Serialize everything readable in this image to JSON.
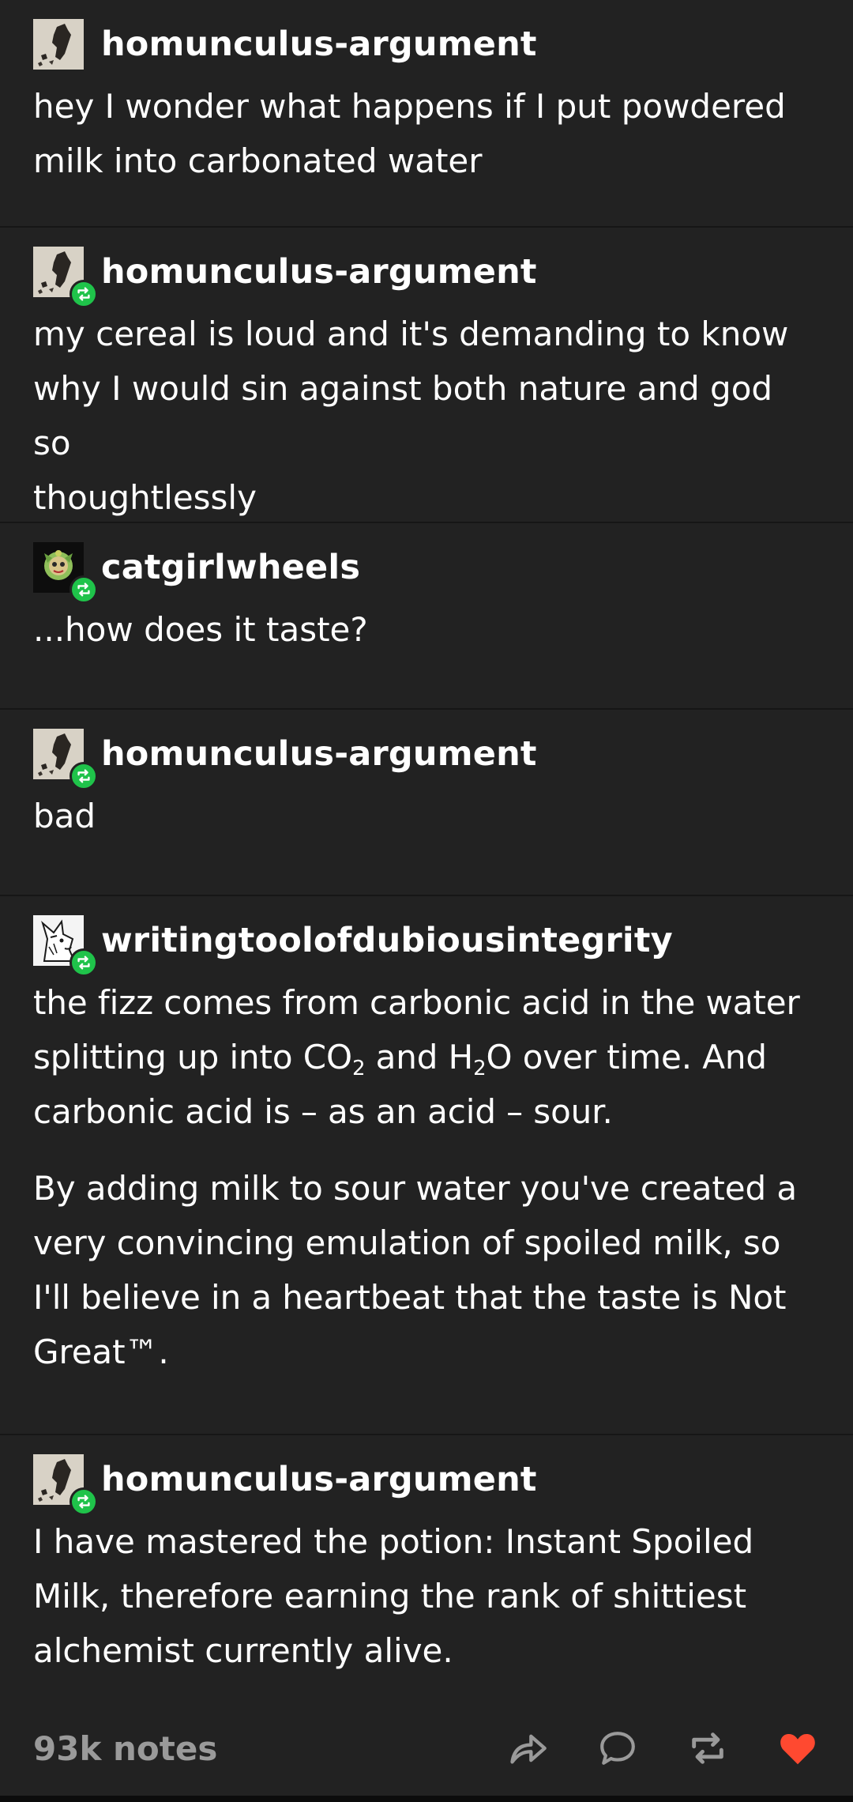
{
  "posts": [
    {
      "username": "homunculus-argument",
      "avatar": "homunculus-argument-avatar",
      "reblogged": false,
      "paragraphs": [
        [
          "hey I wonder what happens if I put powdered",
          "milk into carbonated water"
        ]
      ]
    },
    {
      "username": "homunculus-argument",
      "avatar": "homunculus-argument-avatar",
      "reblogged": true,
      "paragraphs": [
        [
          "my cereal is loud and it's demanding to know",
          "why I would sin against both nature and god so",
          "thoughtlessly"
        ]
      ]
    },
    {
      "username": "catgirlwheels",
      "avatar": "catgirlwheels-avatar",
      "reblogged": true,
      "paragraphs": [
        [
          "...how does it taste?"
        ]
      ]
    },
    {
      "username": "homunculus-argument",
      "avatar": "homunculus-argument-avatar",
      "reblogged": true,
      "paragraphs": [
        [
          "bad"
        ]
      ]
    },
    {
      "username": "writingtoolofdubiousintegrity",
      "avatar": "writingtoolofdubiousintegrity-avatar",
      "reblogged": true,
      "line1": "the fizz comes from carbonic acid in the water",
      "line2_a": "splitting up into CO",
      "line2_sub1": "2",
      "line2_b": " and H",
      "line2_sub2": "2",
      "line2_c": "O over time. And",
      "line3": "carbonic acid is – as an acid – sour.",
      "para2": [
        "By adding milk to sour water you've created a",
        "very convincing emulation of spoiled milk, so",
        "I'll believe in a heartbeat that the taste is Not",
        "Great™."
      ]
    },
    {
      "username": "homunculus-argument",
      "avatar": "homunculus-argument-avatar",
      "reblogged": true,
      "paragraphs": [
        [
          "I have mastered the potion: Instant Spoiled",
          "Milk, therefore earning the rank of shittiest",
          "alchemist currently alive."
        ]
      ]
    }
  ],
  "footer": {
    "notes": "93k notes",
    "icons": [
      "share-icon",
      "reply-icon",
      "reblog-icon",
      "like-icon"
    ],
    "like_color": "#ff4930",
    "icon_color": "#9a9a9a"
  },
  "colors": {
    "background": "#222222",
    "divider": "#161616",
    "reblog_badge": "#1fc34a"
  }
}
